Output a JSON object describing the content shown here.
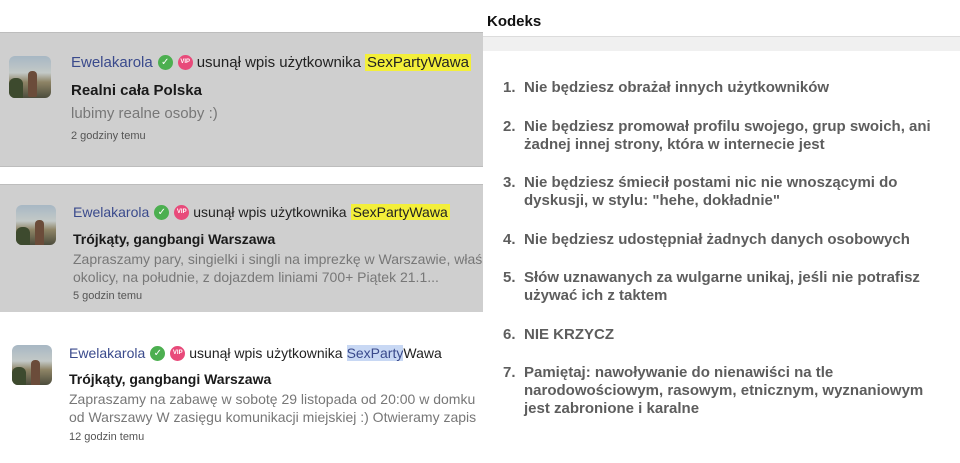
{
  "activity": [
    {
      "user": "Ewelakarola",
      "action": "usunął wpis użytkownika",
      "target": "SexPartyWawa",
      "title": "Realni cała Polska",
      "body": [
        "lubimy realne osoby :)"
      ],
      "time": "2 godziny temu"
    },
    {
      "user": "Ewelakarola",
      "action": "usunął wpis użytkownika",
      "target": "SexPartyWawa",
      "title": "Trójkąty, gangbangi Warszawa",
      "body": [
        "Zapraszamy pary, singielki i singli na imprezkę w Warszawie, właś",
        "okolicy, na południe, z dojazdem liniami 700+ Piątek 21.1..."
      ],
      "time": "5 godzin temu"
    },
    {
      "user": "Ewelakarola",
      "action": "usunął wpis użytkownika",
      "target_highlight": "SexParty",
      "target_rest": "Wawa",
      "title": "Trójkąty, gangbangi Warszawa",
      "body": [
        "Zapraszamy na zabawę w sobotę 29 listopada od 20:00 w domku",
        "od Warszawy W zasięgu komunikacji miejskiej :) Otwieramy zapis"
      ],
      "time": "12 godzin temu"
    }
  ],
  "badges": {
    "verified": "✓",
    "vip": "VIP"
  },
  "kodeks": {
    "title": "Kodeks",
    "rules": [
      {
        "num": "1.",
        "text": "Nie będziesz obrażał innych użytkowników"
      },
      {
        "num": "2.",
        "text": "Nie będziesz promował profilu swojego, grup swoich, ani żadnej innej strony, która w internecie jest"
      },
      {
        "num": "3.",
        "text": "Nie będziesz śmiecił postami nic nie wnoszącymi do dyskusji, w stylu: \"hehe, dokładnie\""
      },
      {
        "num": "4.",
        "text": "Nie będziesz udostępniał żadnych danych osobowych"
      },
      {
        "num": "5.",
        "text": "Słów uznawanych za wulgarne unikaj, jeśli nie potrafisz używać ich z taktem"
      },
      {
        "num": "6.",
        "text": "NIE KRZYCZ"
      },
      {
        "num": "7.",
        "text": "Pamiętaj: nawoływanie do nienawiści na tle narodowościowym, rasowym, etnicznym, wyznaniowym jest zabronione i karalne"
      }
    ]
  },
  "colors": {
    "username": "#3a4a8c",
    "highlight": "#f3ef3a",
    "verified": "#4caf50",
    "vip": "#e84a7a",
    "deleted_bg": "#cfcfcf"
  }
}
